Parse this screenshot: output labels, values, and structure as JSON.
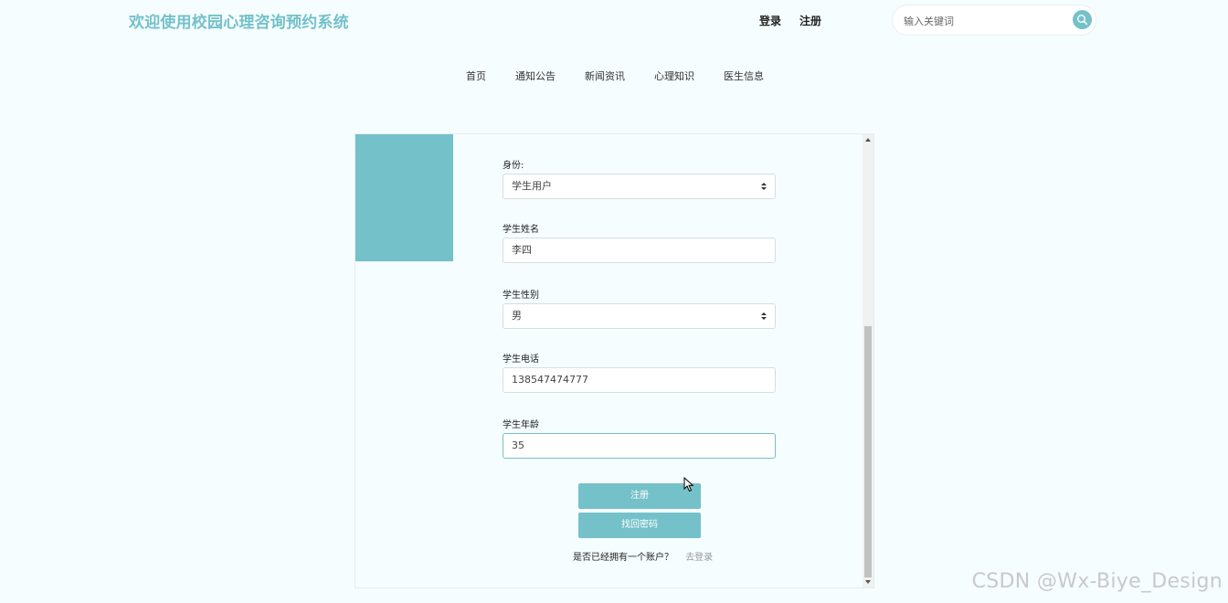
{
  "header": {
    "site_title": "欢迎使用校园心理咨询预约系统",
    "login_link": "登录",
    "register_link": "注册",
    "search": {
      "placeholder": "输入关键词",
      "icon": "search-icon"
    }
  },
  "nav": {
    "items": [
      {
        "label": "首页"
      },
      {
        "label": "通知公告"
      },
      {
        "label": "新闻资讯"
      },
      {
        "label": "心理知识"
      },
      {
        "label": "医生信息"
      }
    ]
  },
  "form": {
    "identity": {
      "label": "身份:",
      "value": "学生用户"
    },
    "name": {
      "label": "学生姓名",
      "value": "李四"
    },
    "gender": {
      "label": "学生性别",
      "value": "男"
    },
    "phone": {
      "label": "学生电话",
      "value": "138547474777"
    },
    "age": {
      "label": "学生年龄",
      "value": "35"
    },
    "register_button": "注册",
    "recover_button": "找回密码",
    "login_question": "是否已经拥有一个账户？",
    "login_link": "去登录"
  },
  "watermark": "CSDN @Wx-Biye_Design",
  "colors": {
    "accent": "#74c1c9",
    "background": "#f5fdfe"
  }
}
